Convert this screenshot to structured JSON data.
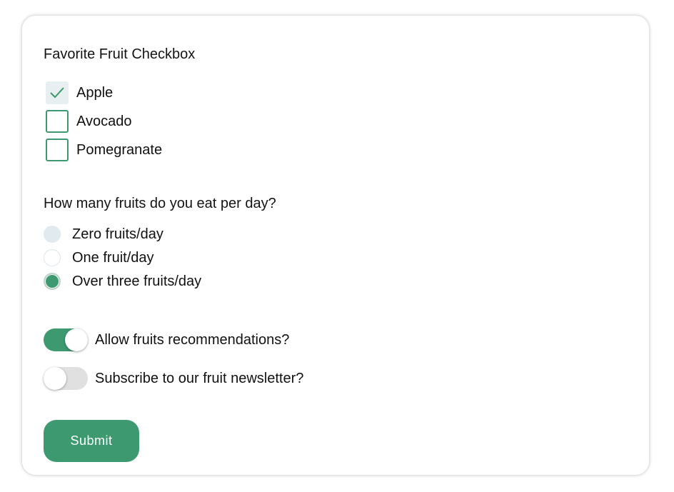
{
  "form": {
    "checkbox_section": {
      "title": "Favorite Fruit Checkbox",
      "options": [
        {
          "label": "Apple",
          "checked": true
        },
        {
          "label": "Avocado",
          "checked": false
        },
        {
          "label": "Pomegranate",
          "checked": false
        }
      ]
    },
    "radio_section": {
      "title": "How many fruits do you eat per day?",
      "options": [
        {
          "label": "Zero fruits/day",
          "selected": false
        },
        {
          "label": "One fruit/day",
          "selected": false
        },
        {
          "label": "Over three fruits/day",
          "selected": true
        }
      ]
    },
    "toggles": [
      {
        "label": "Allow fruits recommendations?",
        "on": true
      },
      {
        "label": "Subscribe to our fruit newsletter?",
        "on": false
      }
    ],
    "submit_label": "Submit"
  },
  "colors": {
    "accent": "#3d9970",
    "toggle_off": "#e0e0e0",
    "checkbox_checked_bg": "#e8eff0"
  }
}
